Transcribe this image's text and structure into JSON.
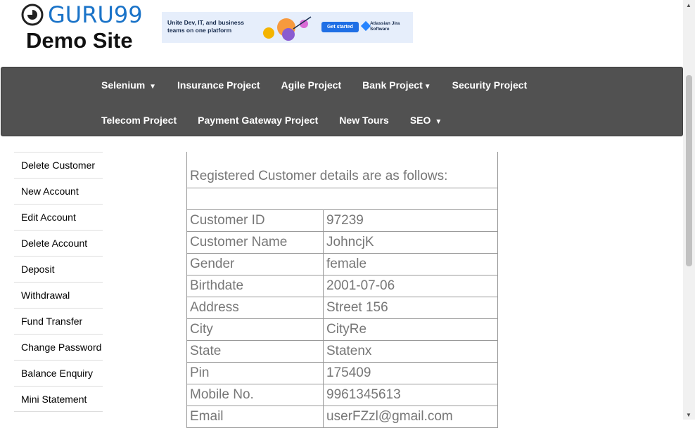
{
  "logo": {
    "brand": "GURU99",
    "subtitle": "Demo Site"
  },
  "banner": {
    "text": "Unite Dev, IT, and business teams on one platform",
    "button": "Get started",
    "brand": "Atlassian Jira Software"
  },
  "nav": {
    "row1": [
      {
        "label": "Selenium",
        "dropdown": true
      },
      {
        "label": "Insurance Project",
        "dropdown": false
      },
      {
        "label": "Agile Project",
        "dropdown": false
      },
      {
        "label": "Bank Project",
        "dropdown": true
      },
      {
        "label": "Security Project",
        "dropdown": false
      }
    ],
    "row2": [
      {
        "label": "Telecom Project",
        "dropdown": false
      },
      {
        "label": "Payment Gateway Project",
        "dropdown": false
      },
      {
        "label": "New Tours",
        "dropdown": false
      },
      {
        "label": "SEO",
        "dropdown": true
      }
    ]
  },
  "sidebar": {
    "items": [
      "Delete Customer",
      "New Account",
      "Edit Account",
      "Delete Account",
      "Deposit",
      "Withdrawal",
      "Fund Transfer",
      "Change Password",
      "Balance Enquiry",
      "Mini Statement"
    ]
  },
  "details": {
    "heading": "Registered Customer details are as follows:",
    "rows": [
      {
        "label": "Customer ID",
        "value": "97239"
      },
      {
        "label": "Customer Name",
        "value": "JohncjK"
      },
      {
        "label": "Gender",
        "value": "female"
      },
      {
        "label": "Birthdate",
        "value": "2001-07-06"
      },
      {
        "label": "Address",
        "value": "Street 156"
      },
      {
        "label": "City",
        "value": "CityRe"
      },
      {
        "label": "State",
        "value": "Statenx"
      },
      {
        "label": "Pin",
        "value": "175409"
      },
      {
        "label": "Mobile No.",
        "value": "9961345613"
      },
      {
        "label": "Email",
        "value": "userFZzl@gmail.com"
      }
    ]
  }
}
